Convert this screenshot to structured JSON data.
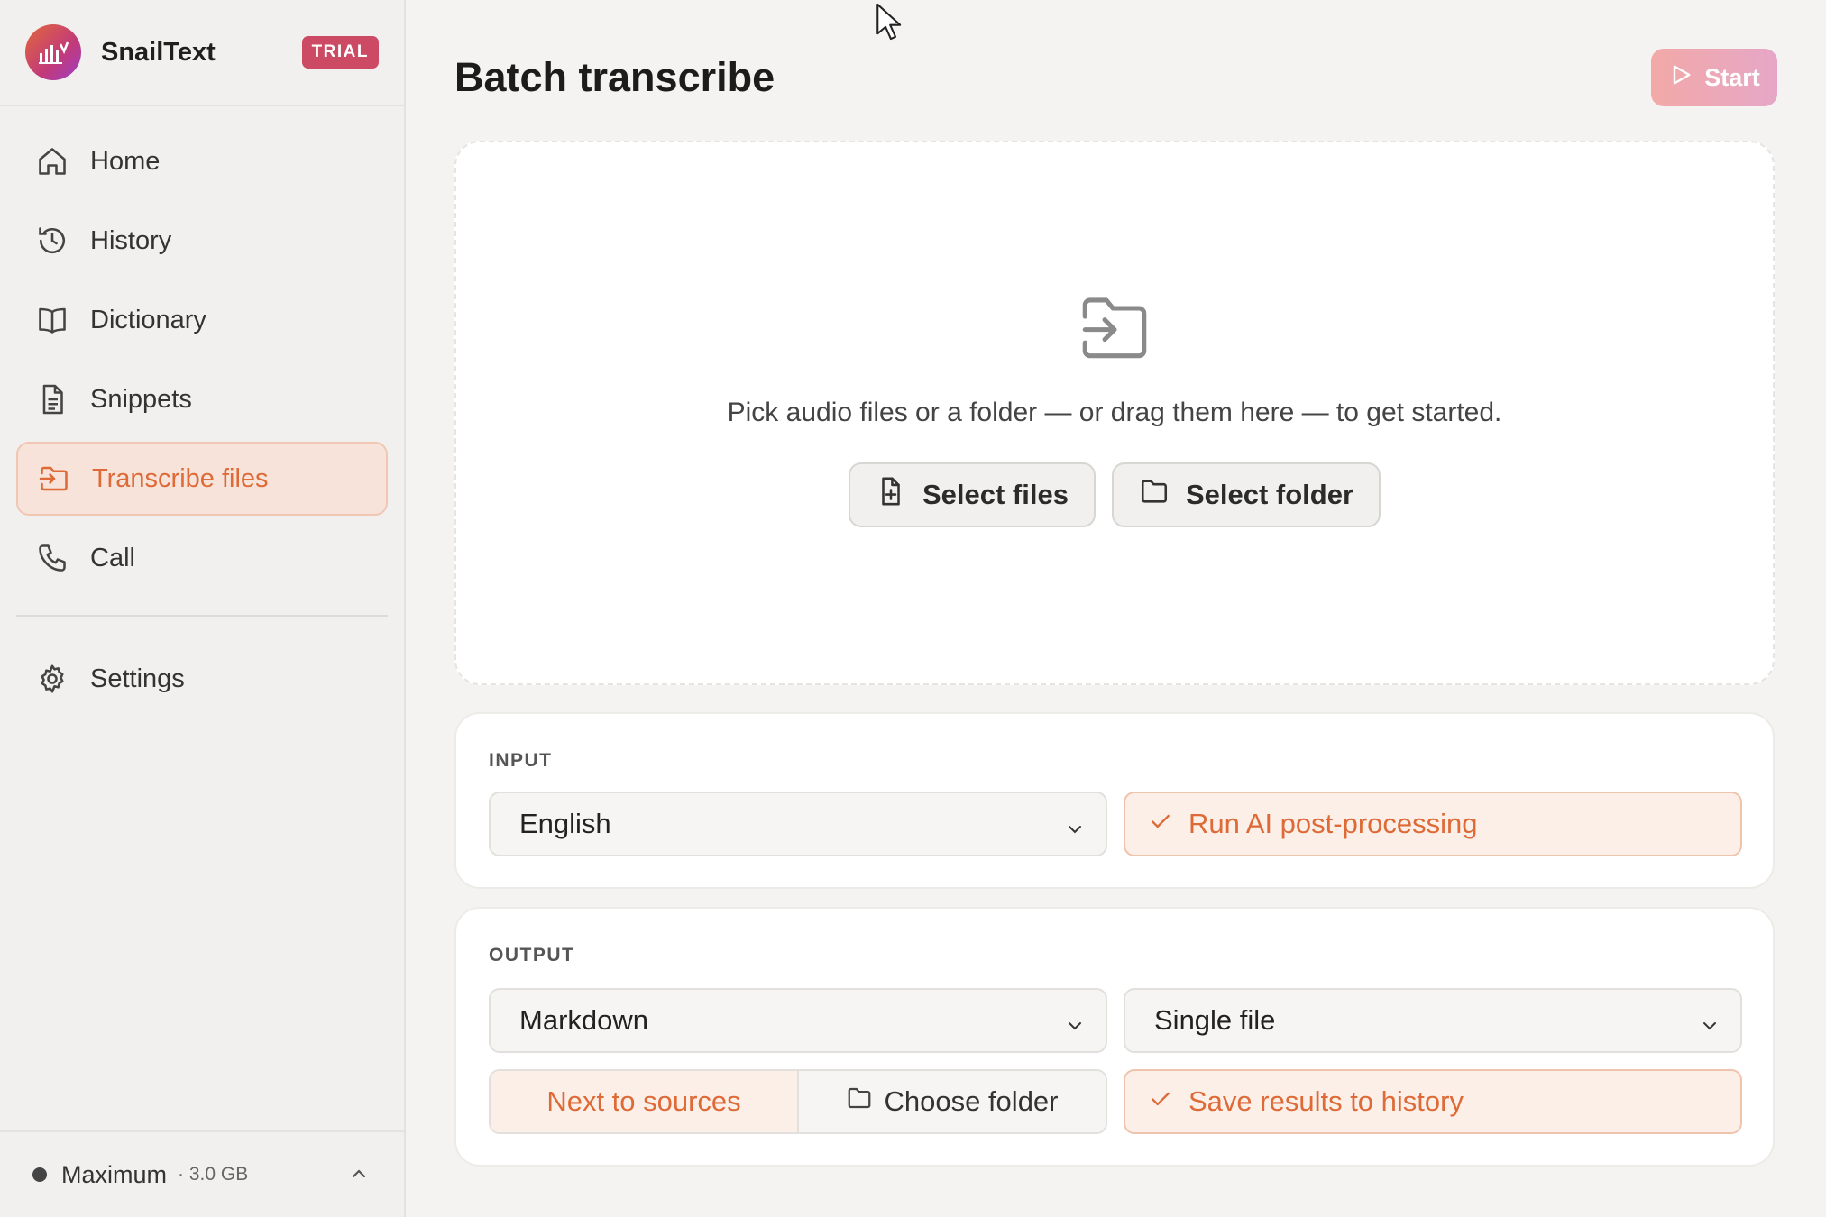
{
  "app": {
    "name": "SnailText",
    "badge": "TRIAL"
  },
  "sidebar": {
    "items": [
      {
        "label": "Home",
        "icon": "home-icon"
      },
      {
        "label": "History",
        "icon": "history-icon"
      },
      {
        "label": "Dictionary",
        "icon": "book-icon"
      },
      {
        "label": "Snippets",
        "icon": "document-icon"
      },
      {
        "label": "Transcribe files",
        "icon": "folder-input-icon",
        "active": true
      },
      {
        "label": "Call",
        "icon": "phone-icon"
      },
      {
        "label": "Settings",
        "icon": "gear-icon"
      }
    ],
    "footer": {
      "model": "Maximum",
      "size": "· 3.0 GB"
    }
  },
  "main": {
    "title": "Batch transcribe",
    "start_label": "Start",
    "dropzone": {
      "text": "Pick audio files or a folder — or drag them here — to get started.",
      "select_files": "Select files",
      "select_folder": "Select folder"
    },
    "input": {
      "label": "INPUT",
      "language": "English",
      "ai_postprocess": "Run AI post-processing"
    },
    "output": {
      "label": "OUTPUT",
      "format": "Markdown",
      "mode": "Single file",
      "location_next": "Next to sources",
      "location_choose": "Choose folder",
      "save_history": "Save results to history"
    }
  },
  "colors": {
    "accent": "#dd6a37",
    "accent_bg": "#fcefe8",
    "trial_badge": "#cc4a63"
  }
}
